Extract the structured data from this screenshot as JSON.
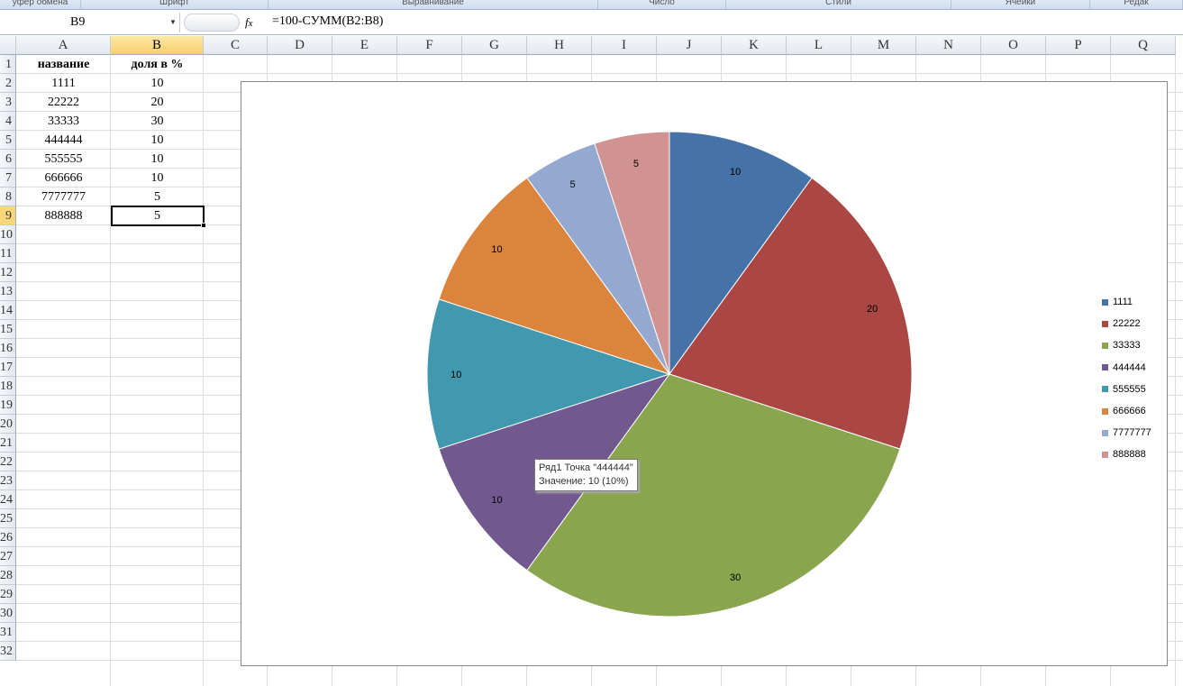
{
  "ribbon": {
    "groups": [
      "уфер обмена",
      "Шрифт",
      "Выравнивание",
      "Число",
      "Стили",
      "Ячейки",
      "Редак"
    ]
  },
  "formula_bar": {
    "name_box": "B9",
    "fx": "fx",
    "formula": "=100-СУММ(B2:B8)"
  },
  "columns": [
    "A",
    "B",
    "C",
    "D",
    "E",
    "F",
    "G",
    "H",
    "I",
    "J",
    "K",
    "L",
    "M",
    "N",
    "O",
    "P",
    "Q"
  ],
  "rows": [
    "1",
    "2",
    "3",
    "4",
    "5",
    "6",
    "7",
    "8",
    "9",
    "10",
    "11",
    "12",
    "13",
    "14",
    "15",
    "16",
    "17",
    "18",
    "19",
    "20",
    "21",
    "22",
    "23",
    "24",
    "25",
    "26",
    "27",
    "28",
    "29",
    "30",
    "31",
    "32"
  ],
  "sheet": {
    "headers": [
      "название",
      "доля в %"
    ],
    "data": [
      [
        "1111",
        "10"
      ],
      [
        "22222",
        "20"
      ],
      [
        "33333",
        "30"
      ],
      [
        "444444",
        "10"
      ],
      [
        "555555",
        "10"
      ],
      [
        "666666",
        "10"
      ],
      [
        "7777777",
        "5"
      ],
      [
        "888888",
        "5"
      ]
    ]
  },
  "chart_data": {
    "type": "pie",
    "categories": [
      "1111",
      "22222",
      "33333",
      "444444",
      "555555",
      "666666",
      "7777777",
      "888888"
    ],
    "values": [
      10,
      20,
      30,
      10,
      10,
      10,
      5,
      5
    ],
    "labels": [
      "10",
      "20",
      "30",
      "10",
      "10",
      "10",
      "5",
      "5"
    ],
    "colors": [
      "#4572A7",
      "#AA4643",
      "#89A54E",
      "#71588F",
      "#4198AF",
      "#DB843D",
      "#93A9CF",
      "#D19392"
    ],
    "legend_position": "right",
    "series_name": "Ряд1"
  },
  "tooltip": {
    "line1": "Ряд1 Точка \"444444\"",
    "line2": "Значение: 10 (10%)"
  }
}
